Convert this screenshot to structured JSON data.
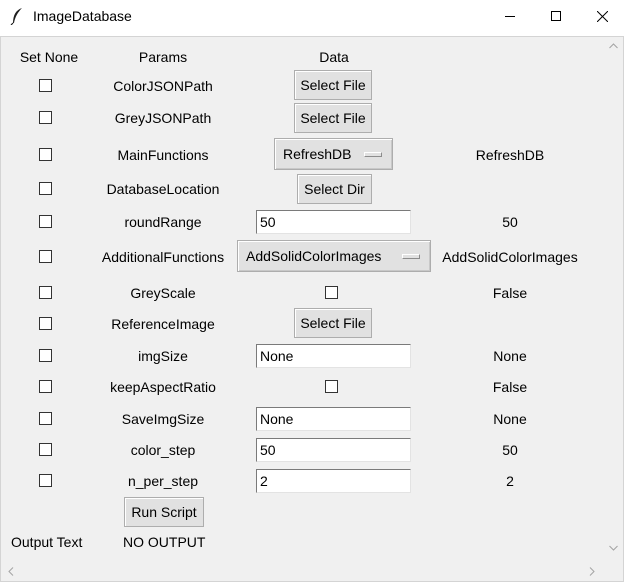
{
  "window": {
    "title": "ImageDatabase",
    "icon": "feather-icon"
  },
  "headers": {
    "set_none": "Set None",
    "params": "Params",
    "data": "Data"
  },
  "rows": [
    {
      "param": "ColorJSONPath",
      "button": "Select File"
    },
    {
      "param": "GreyJSONPath",
      "button": "Select File"
    },
    {
      "param": "MainFunctions",
      "menu": "RefreshDB",
      "value": "RefreshDB"
    },
    {
      "param": "DatabaseLocation",
      "button": "Select Dir"
    },
    {
      "param": "roundRange",
      "entry": "50",
      "value": "50"
    },
    {
      "param": "AdditionalFunctions",
      "menu": "AddSolidColorImages",
      "value": "AddSolidColorImages"
    },
    {
      "param": "GreyScale",
      "checked": false,
      "value": "False"
    },
    {
      "param": "ReferenceImage",
      "button": "Select File"
    },
    {
      "param": "imgSize",
      "entry": "None",
      "value": "None"
    },
    {
      "param": "keepAspectRatio",
      "checked": false,
      "value": "False"
    },
    {
      "param": "SaveImgSize",
      "entry": "None",
      "value": "None"
    },
    {
      "param": "color_step",
      "entry": "50",
      "value": "50"
    },
    {
      "param": "n_per_step",
      "entry": "2",
      "value": "2"
    }
  ],
  "run_button": "Run Script",
  "output": {
    "label": "Output Text",
    "text": "NO OUTPUT"
  }
}
